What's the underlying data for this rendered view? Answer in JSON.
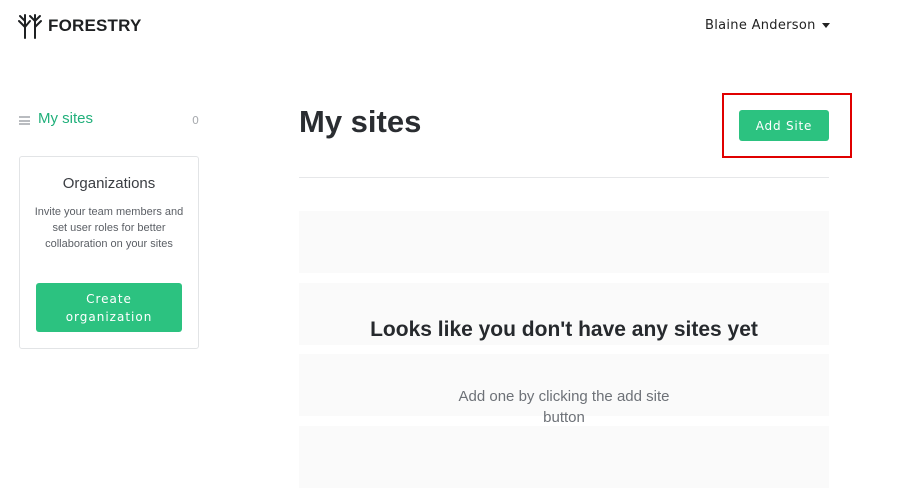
{
  "header": {
    "logo_text": "FORESTRY",
    "user_name": "Blaine Anderson"
  },
  "sidebar": {
    "nav_item": {
      "label": "My sites",
      "count": "0"
    },
    "organizations": {
      "title": "Organizations",
      "description": "Invite your team members and set user roles for better collaboration on your sites",
      "button_label": "Create organization"
    }
  },
  "main": {
    "title": "My sites",
    "add_site_label": "Add Site",
    "empty_state": {
      "title": "Looks like you don't have any sites yet",
      "subtitle": "Add one by clicking the add site button"
    }
  },
  "colors": {
    "accent": "#2cc280",
    "highlight": "#e00000"
  },
  "icons": {
    "logo": "forestry-tree-logo-icon",
    "nav": "list-icon",
    "dropdown": "chevron-down-icon"
  }
}
